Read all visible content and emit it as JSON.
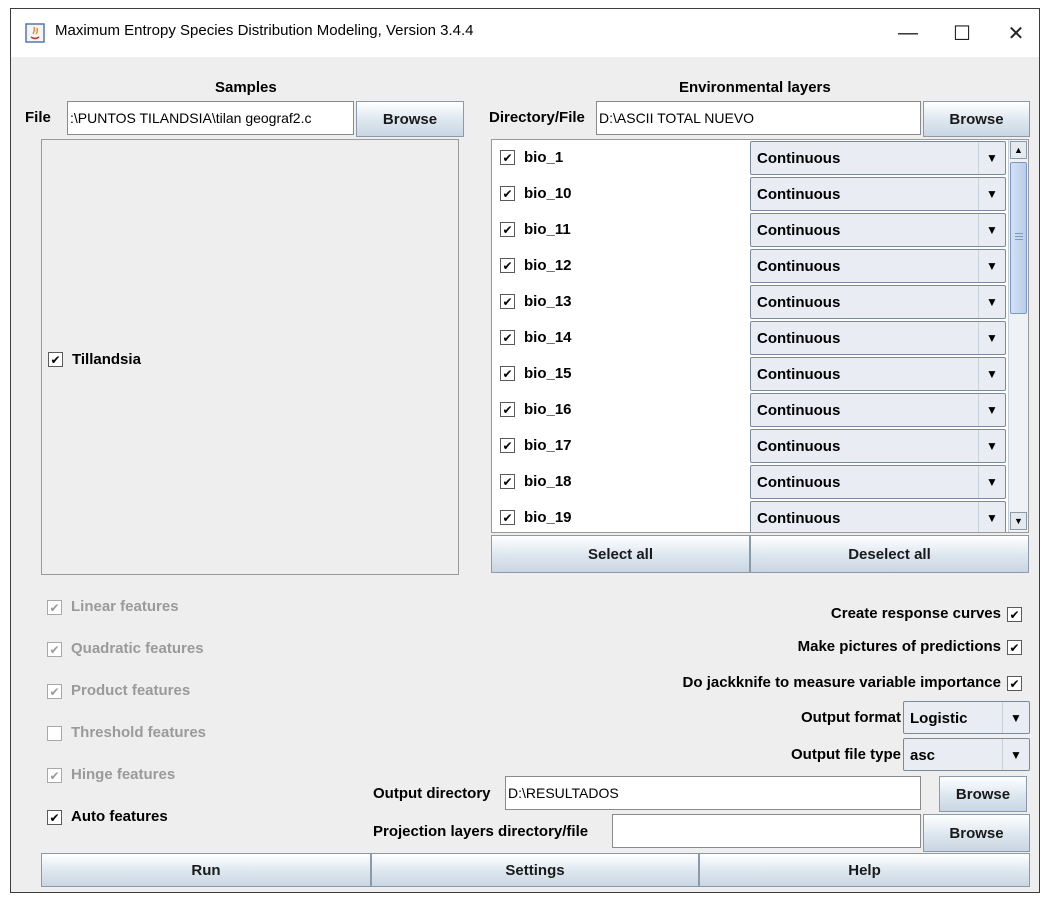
{
  "window": {
    "title": "Maximum Entropy Species Distribution Modeling, Version 3.4.4",
    "minimize_glyph": "—",
    "maximize_glyph": "☐",
    "close_glyph": "✕"
  },
  "samples": {
    "header": "Samples",
    "file_label": "File",
    "file_value": ":\\PUNTOS TILANDSIA\\tilan geograf2.c",
    "browse_label": "Browse",
    "species": [
      {
        "name": "Tillandsia",
        "checked": true
      }
    ]
  },
  "env": {
    "header": "Environmental layers",
    "dir_label": "Directory/File",
    "dir_value": "D:\\ASCII TOTAL NUEVO",
    "browse_label": "Browse",
    "layers": [
      {
        "name": "bio_1",
        "type": "Continuous",
        "checked": true
      },
      {
        "name": "bio_10",
        "type": "Continuous",
        "checked": true
      },
      {
        "name": "bio_11",
        "type": "Continuous",
        "checked": true
      },
      {
        "name": "bio_12",
        "type": "Continuous",
        "checked": true
      },
      {
        "name": "bio_13",
        "type": "Continuous",
        "checked": true
      },
      {
        "name": "bio_14",
        "type": "Continuous",
        "checked": true
      },
      {
        "name": "bio_15",
        "type": "Continuous",
        "checked": true
      },
      {
        "name": "bio_16",
        "type": "Continuous",
        "checked": true
      },
      {
        "name": "bio_17",
        "type": "Continuous",
        "checked": true
      },
      {
        "name": "bio_18",
        "type": "Continuous",
        "checked": true
      },
      {
        "name": "bio_19",
        "type": "Continuous",
        "checked": true
      }
    ],
    "select_all_label": "Select all",
    "deselect_all_label": "Deselect all"
  },
  "features": [
    {
      "label": "Linear features",
      "checked": true,
      "enabled": false
    },
    {
      "label": "Quadratic features",
      "checked": true,
      "enabled": false
    },
    {
      "label": "Product features",
      "checked": true,
      "enabled": false
    },
    {
      "label": "Threshold features",
      "checked": false,
      "enabled": false
    },
    {
      "label": "Hinge features",
      "checked": true,
      "enabled": false
    },
    {
      "label": "Auto features",
      "checked": true,
      "enabled": true
    }
  ],
  "options": {
    "response_curves": "Create response curves",
    "pictures": "Make pictures of predictions",
    "jackknife": "Do jackknife to measure variable importance",
    "output_format_label": "Output format",
    "output_format_value": "Logistic",
    "output_type_label": "Output file type",
    "output_type_value": "asc",
    "output_dir_label": "Output directory",
    "output_dir_value": "D:\\RESULTADOS",
    "projection_label": "Projection layers directory/file",
    "projection_value": "",
    "browse_label": "Browse"
  },
  "actions": {
    "run": "Run",
    "settings": "Settings",
    "help": "Help"
  },
  "glyphs": {
    "check": "✔",
    "dropdown": "▼",
    "scroll_up": "▲",
    "scroll_down": "▼"
  }
}
